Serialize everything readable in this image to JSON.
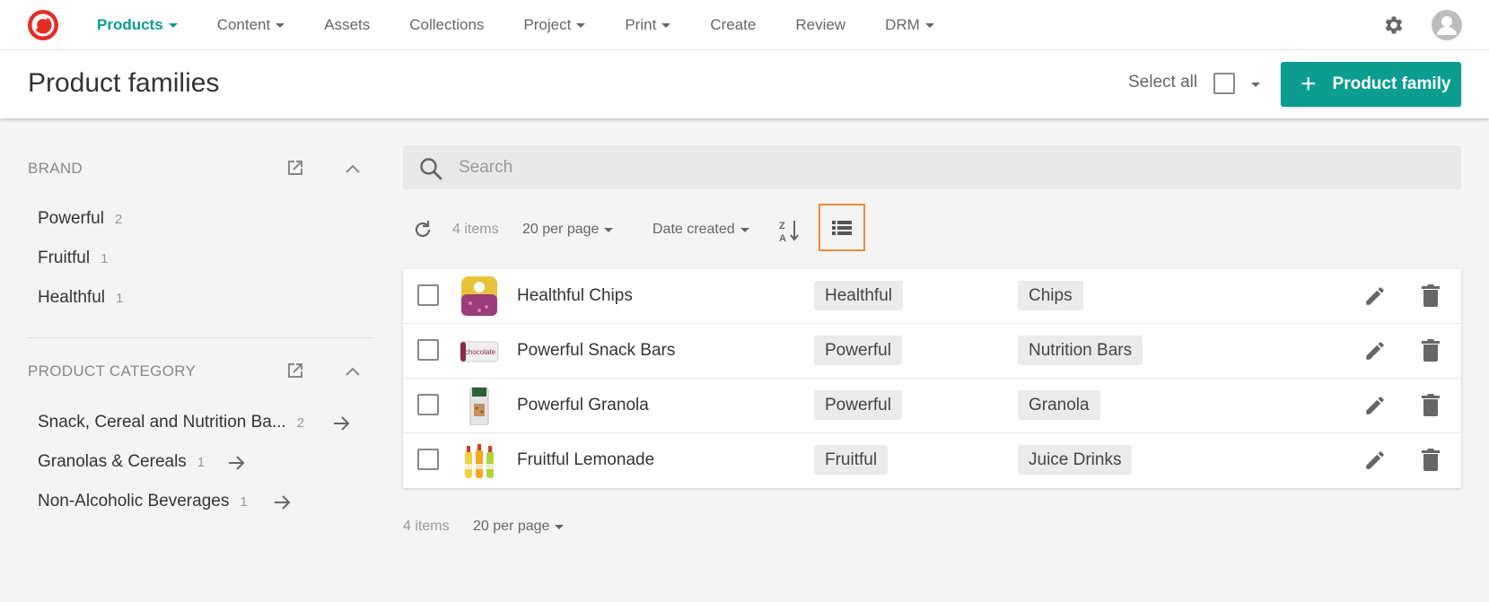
{
  "colors": {
    "brand": "#e52d27",
    "accent": "#0b9d8f",
    "highlight": "#f08a3c"
  },
  "nav": {
    "logo_icon": "sitecore-logo",
    "items": [
      {
        "label": "Products",
        "dropdown": true,
        "active": true
      },
      {
        "label": "Content",
        "dropdown": true
      },
      {
        "label": "Assets",
        "dropdown": false
      },
      {
        "label": "Collections",
        "dropdown": false
      },
      {
        "label": "Project",
        "dropdown": true
      },
      {
        "label": "Print",
        "dropdown": true
      },
      {
        "label": "Create",
        "dropdown": false
      },
      {
        "label": "Review",
        "dropdown": false
      },
      {
        "label": "DRM",
        "dropdown": true
      }
    ],
    "settings_icon": "gear-icon",
    "avatar_icon": "user-avatar-icon"
  },
  "header": {
    "title": "Product families",
    "select_all_label": "Select all",
    "add_button_label": "Product family"
  },
  "sidebar": {
    "brand": {
      "title": "BRAND",
      "items": [
        {
          "label": "Powerful",
          "count": "2"
        },
        {
          "label": "Fruitful",
          "count": "1"
        },
        {
          "label": "Healthful",
          "count": "1"
        }
      ]
    },
    "category": {
      "title": "PRODUCT CATEGORY",
      "items": [
        {
          "label": "Snack, Cereal and Nutrition Ba...",
          "count": "2"
        },
        {
          "label": "Granolas & Cereals",
          "count": "1"
        },
        {
          "label": "Non-Alcoholic Beverages",
          "count": "1"
        }
      ]
    }
  },
  "search": {
    "placeholder": "Search",
    "value": ""
  },
  "toolbar": {
    "item_count": "4 items",
    "per_page": "20 per page",
    "sort_by": "Date created",
    "sort_direction_icon": "sort-z-a-icon",
    "view_icon": "list-view-icon"
  },
  "rows": [
    {
      "name": "Healthful Chips",
      "brand": "Healthful",
      "category": "Chips",
      "thumb": "chips-bag"
    },
    {
      "name": "Powerful Snack Bars",
      "brand": "Powerful",
      "category": "Nutrition Bars",
      "thumb": "snack-bar",
      "thumb_text": "chocolate"
    },
    {
      "name": "Powerful Granola",
      "brand": "Powerful",
      "category": "Granola",
      "thumb": "granola-bag"
    },
    {
      "name": "Fruitful Lemonade",
      "brand": "Fruitful",
      "category": "Juice Drinks",
      "thumb": "juice-bottles"
    }
  ],
  "footer": {
    "item_count": "4 items",
    "per_page": "20 per page"
  }
}
